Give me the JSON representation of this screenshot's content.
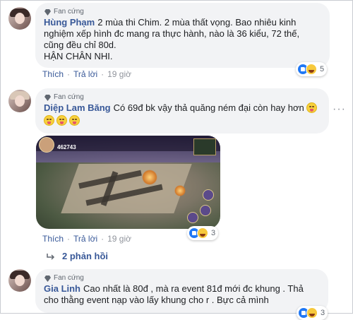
{
  "comments": [
    {
      "badge": "Fan cứng",
      "name": "Hùng Phạm",
      "text": "2 mùa thi Chim. 2 mùa thất vọng. Bao nhiêu kinh nghiệm xếp hình đc mang ra thực hành, nào là 36 kiểu, 72 thế, cũng đều chỉ 80d.",
      "text2": "HẬN CHÂN NHI.",
      "actions": {
        "like": "Thích",
        "reply": "Trả lời",
        "time": "19 giờ"
      },
      "reaction_count": "5"
    },
    {
      "badge": "Fan cứng",
      "name": "Diệp Lam Băng",
      "text": "Có 69đ bk vậy thả quăng ném đại còn hay hơn",
      "actions": {
        "like": "Thích",
        "reply": "Trả lời",
        "time": "19 giờ"
      },
      "reaction_count": "3"
    },
    {
      "badge": "Fan cứng",
      "name": "Gia Linh",
      "text": "Cao nhất là 80đ , mà ra event 81đ mới đc khung . Thả cho thằng event nạp vào lấy khung cho r . Bực cả mình",
      "reaction_count": "3"
    }
  ],
  "game_hud": {
    "power": "462743"
  },
  "replies_link": "2 phản hồi",
  "colors": {
    "link": "#385898",
    "bubble": "#f2f3f5",
    "meta": "#90949c",
    "like_blue": "#2078f4"
  },
  "icons": [
    "fan-badge-icon",
    "like-reaction-icon",
    "haha-reaction-icon",
    "more-options-icon",
    "reply-arrow-icon",
    "emoji-tongue-icon"
  ]
}
